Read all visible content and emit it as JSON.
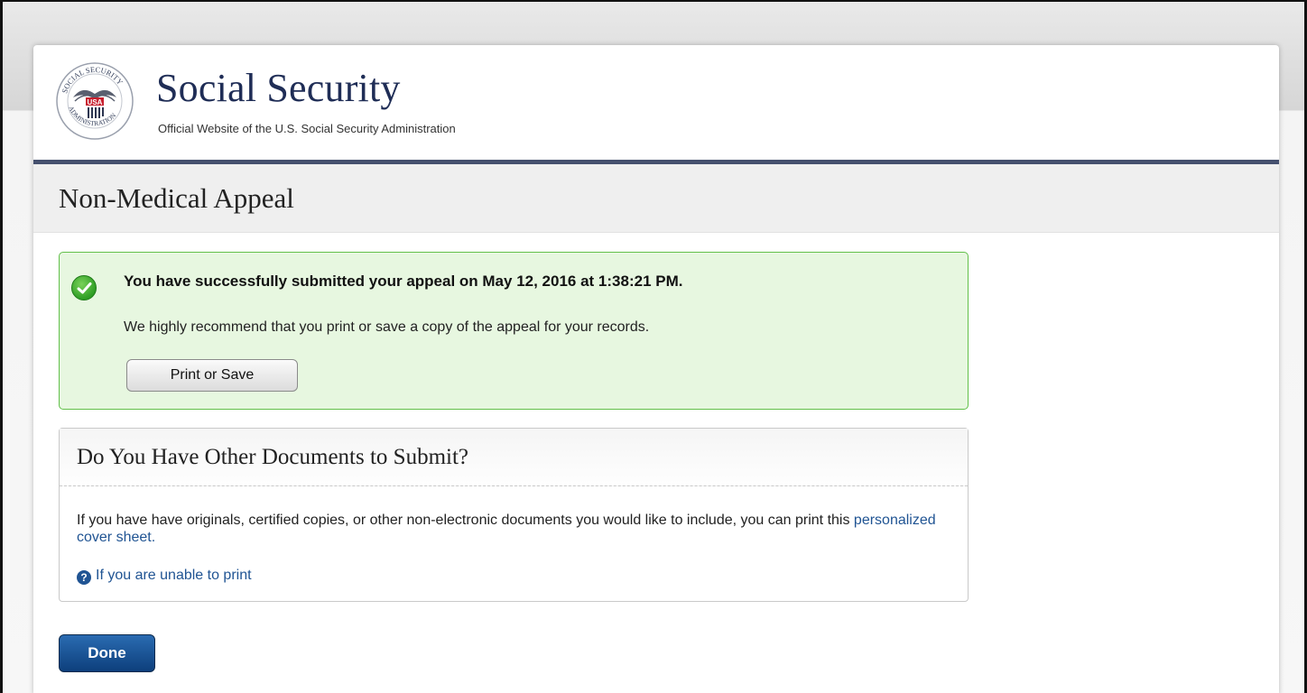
{
  "header": {
    "brand_title": "Social Security",
    "brand_subtitle": "Official Website of the U.S. Social Security Administration",
    "seal_text": "SOCIAL SECURITY ADMINISTRATION USA"
  },
  "page": {
    "title": "Non-Medical Appeal"
  },
  "success": {
    "title": "You have successfully submitted your appeal on May 12, 2016 at 1:38:21 PM.",
    "message": "We highly recommend that you print or save a copy of the appeal for your records.",
    "button_label": "Print or Save"
  },
  "documents": {
    "heading": "Do You Have Other Documents to Submit?",
    "body_text": "If you have have originals, certified copies, or other non-electronic documents you would like to include, you can print this ",
    "cover_sheet_link": "personalized cover sheet.",
    "help_icon_glyph": "?",
    "help_link": "If you are unable to print"
  },
  "actions": {
    "done_label": "Done"
  },
  "colors": {
    "brand_navy": "#1f2d56",
    "header_rule": "#45506e",
    "success_border": "#62c04a",
    "success_bg": "#e7f7e0",
    "link": "#205493",
    "done_button": "#0d3f7c"
  }
}
